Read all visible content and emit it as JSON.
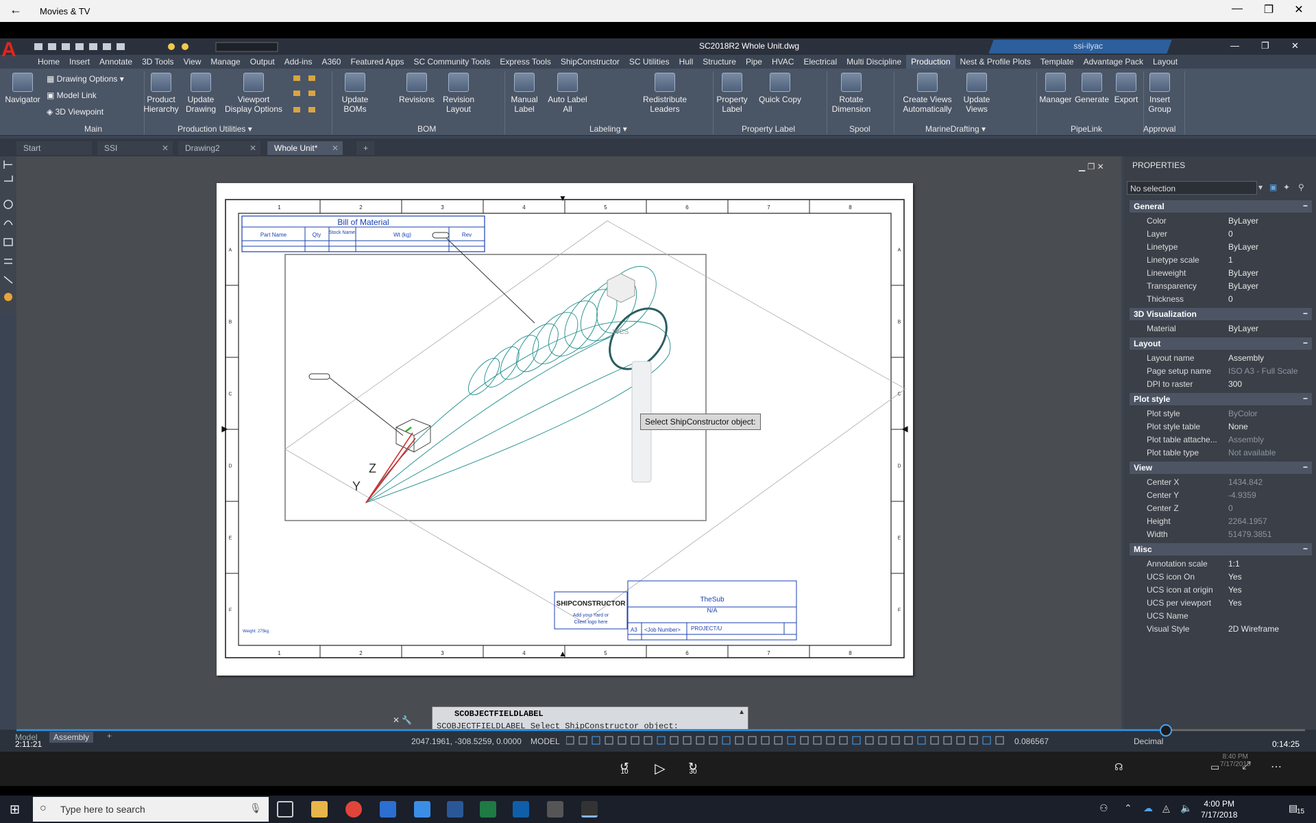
{
  "window": {
    "app_title": "Movies & TV",
    "back": "←",
    "minimize": "—",
    "restore": "❐",
    "close": "✕"
  },
  "acad": {
    "file_title": "SC2018R2   Whole Unit.dwg",
    "user": "ssi-ilyac",
    "logo_letter": "A"
  },
  "menu_tabs": [
    "Home",
    "Insert",
    "Annotate",
    "3D Tools",
    "View",
    "Manage",
    "Output",
    "Add-ins",
    "A360",
    "Featured Apps",
    "SC Community Tools",
    "Express Tools",
    "ShipConstructor",
    "SC Utilities",
    "Hull",
    "Structure",
    "Pipe",
    "HVAC",
    "Electrical",
    "Multi Discipline",
    "Production",
    "Nest & Profile Plots",
    "Template",
    "Advantage Pack",
    "Layout"
  ],
  "active_menu_tab": "Production",
  "ribbon": {
    "navigator": "Navigator",
    "drawing_options": "Drawing Options",
    "model_link": "Model Link",
    "viewpoint": "3D Viewpoint",
    "product_hierarchy_1": "Product",
    "product_hierarchy_2": "Hierarchy",
    "update_drawing_1": "Update",
    "update_drawing_2": "Drawing",
    "viewport_1": "Viewport",
    "viewport_2": "Display Options",
    "update_boms_1": "Update",
    "update_boms_2": "BOMs",
    "revisions": "Revisions",
    "revision_layout_1": "Revision",
    "revision_layout_2": "Layout",
    "manual_label_1": "Manual",
    "manual_label_2": "Label",
    "auto_label_1": "Auto Label",
    "auto_label_2": "All",
    "redistribute_1": "Redistribute",
    "redistribute_2": "Leaders",
    "property_label_1": "Property",
    "property_label_2": "Label",
    "quick_copy": "Quick Copy",
    "rotate_dim_1": "Rotate",
    "rotate_dim_2": "Dimension",
    "create_views_1": "Create Views",
    "create_views_2": "Automatically",
    "update_views_1": "Update",
    "update_views_2": "Views",
    "manager": "Manager",
    "generate": "Generate",
    "export": "Export",
    "insert_group_1": "Insert",
    "insert_group_2": "Group",
    "groups": [
      "Main",
      "Production Utilities ▾",
      "BOM",
      "Labeling ▾",
      "Property Label",
      "Spool",
      "MarineDrafting ▾",
      "PipeLink",
      "Approval"
    ]
  },
  "doc_tabs": [
    "Start",
    "SSI",
    "Drawing2",
    "Whole Unit*"
  ],
  "drawing": {
    "bom_title": "Bill of Material",
    "bom_headers": [
      "Part Name",
      "Qty",
      "Stock Name",
      "Wt (kg)",
      "Rev"
    ],
    "tooltip": "Select ShipConstructor object:",
    "wcs": "WCS",
    "col_numbers": [
      "1",
      "2",
      "3",
      "4",
      "5",
      "6",
      "7",
      "8"
    ],
    "row_letters": [
      "A",
      "B",
      "C",
      "D",
      "E",
      "F"
    ],
    "tb_company": "SHIPCONSTRUCTOR",
    "tb_logo_text_1": "Add your Yard or",
    "tb_logo_text_2": "Client logo here",
    "tb_name": "TheSub",
    "tb_na": "N/A",
    "tb_size": "A3",
    "tb_job": "<Job Number>",
    "tb_project": "PROJECT/U",
    "weight_note": "Weight: 275kg",
    "axis_y": "Y",
    "axis_z": "Z"
  },
  "properties": {
    "header": "PROPERTIES",
    "selection": "No selection",
    "sections": {
      "general": "General",
      "vis3d": "3D Visualization",
      "layout": "Layout",
      "plotstyle": "Plot style",
      "view": "View",
      "misc": "Misc"
    },
    "general": [
      [
        "Color",
        "ByLayer"
      ],
      [
        "Layer",
        "0"
      ],
      [
        "Linetype",
        "ByLayer"
      ],
      [
        "Linetype scale",
        "1"
      ],
      [
        "Lineweight",
        "ByLayer"
      ],
      [
        "Transparency",
        "ByLayer"
      ],
      [
        "Thickness",
        "0"
      ]
    ],
    "vis3d": [
      [
        "Material",
        "ByLayer"
      ]
    ],
    "layout": [
      [
        "Layout name",
        "Assembly"
      ],
      [
        "Page setup name",
        "ISO A3 - Full Scale"
      ],
      [
        "DPI to raster",
        "300"
      ]
    ],
    "plotstyle": [
      [
        "Plot style",
        "ByColor"
      ],
      [
        "Plot style table",
        "None"
      ],
      [
        "Plot table attache...",
        "Assembly"
      ],
      [
        "Plot table type",
        "Not available"
      ]
    ],
    "view": [
      [
        "Center X",
        "1434.842"
      ],
      [
        "Center Y",
        "-4.9359"
      ],
      [
        "Center Z",
        "0"
      ],
      [
        "Height",
        "2264.1957"
      ],
      [
        "Width",
        "51479.3851"
      ]
    ],
    "misc": [
      [
        "Annotation scale",
        "1:1"
      ],
      [
        "UCS icon On",
        "Yes"
      ],
      [
        "UCS icon at origin",
        "Yes"
      ],
      [
        "UCS per viewport",
        "Yes"
      ],
      [
        "UCS Name",
        ""
      ],
      [
        "Visual Style",
        "2D Wireframe"
      ]
    ]
  },
  "command": {
    "line1": "SCOBJECTFIELDLABEL",
    "line2": "SCOBJECTFIELDLABEL Select ShipConstructor object:"
  },
  "status": {
    "coords": "2047.1961, -308.5259, 0.0000",
    "space": "MODEL",
    "units": "Decimal",
    "scale": "0.086567",
    "layout_tabs": [
      "Model",
      "Assembly"
    ]
  },
  "media": {
    "elapsed": "2:11:21",
    "remaining": "0:14:25",
    "skip_back": "10",
    "skip_fwd": "30",
    "progress": 0.892
  },
  "taskbar": {
    "search_placeholder": "Type here to search",
    "time": "4:00 PM",
    "date": "7/17/2018",
    "notif_count": "15",
    "inner_time": "8:40 PM",
    "inner_date": "7/17/2018"
  }
}
